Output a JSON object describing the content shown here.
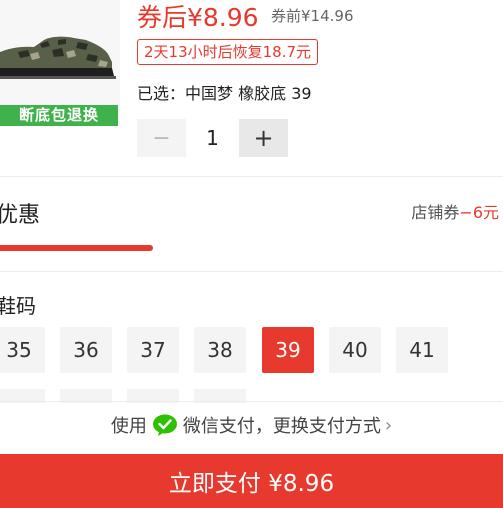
{
  "product": {
    "badge": "断底包退换",
    "price_after_label": "券后¥8.96",
    "price_before_label": "券前¥14.96",
    "countdown": "2天13小时后恢复18.7元",
    "selected_label": "已选：",
    "selected_value": "中国梦 橡胶底 39"
  },
  "stepper": {
    "minus": "−",
    "quantity": "1",
    "plus": "+"
  },
  "discount": {
    "title": "优惠",
    "coupon_label": "店铺券",
    "coupon_amount": "−6元"
  },
  "sizes": {
    "title": "鞋码",
    "options": [
      "35",
      "36",
      "37",
      "38",
      "39",
      "40",
      "41"
    ],
    "selected": "39"
  },
  "payment": {
    "prefix": "使用",
    "method": "微信支付，更换支付方式",
    "chevron": "›"
  },
  "pay_button": {
    "label": "立即支付 ¥8.96"
  },
  "colors": {
    "accent": "#e8392e",
    "wechat": "#2dc100",
    "badge": "#3fb24b"
  }
}
